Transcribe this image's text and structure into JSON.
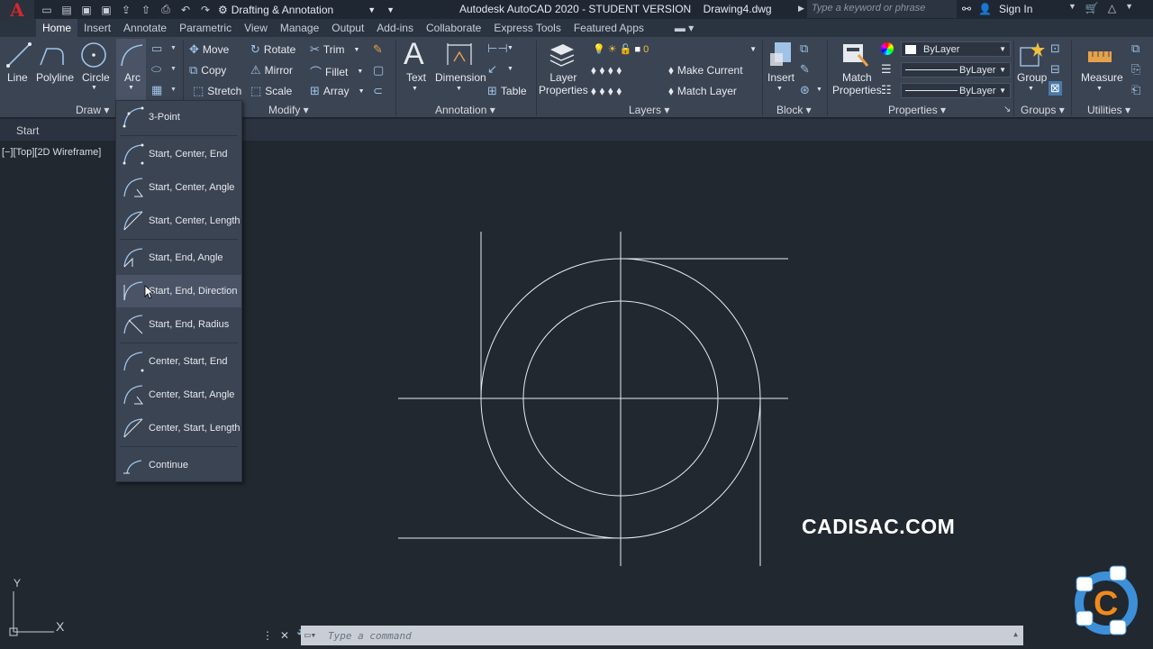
{
  "titlebar": {
    "workspace": "Drafting & Annotation",
    "app_title": "Autodesk AutoCAD 2020 - STUDENT VERSION",
    "drawing_name": "Drawing4.dwg",
    "search_placeholder": "Type a keyword or phrase",
    "signin_label": "Sign In"
  },
  "tabs": [
    "Home",
    "Insert",
    "Annotate",
    "Parametric",
    "View",
    "Manage",
    "Output",
    "Add-ins",
    "Collaborate",
    "Express Tools",
    "Featured Apps"
  ],
  "active_tab": "Home",
  "ribbon": {
    "draw": {
      "line": "Line",
      "polyline": "Polyline",
      "circle": "Circle",
      "arc": "Arc",
      "title": "Draw"
    },
    "modify": {
      "move": "Move",
      "rotate": "Rotate",
      "trim": "Trim",
      "copy": "Copy",
      "mirror": "Mirror",
      "fillet": "Fillet",
      "stretch": "Stretch",
      "scale": "Scale",
      "array": "Array",
      "title": "Modify"
    },
    "annotation": {
      "text": "Text",
      "dimension": "Dimension",
      "table": "Table",
      "title": "Annotation"
    },
    "layers": {
      "layer_properties_1": "Layer",
      "layer_properties_2": "Properties",
      "current_layer": "0",
      "make_current": "Make Current",
      "match_layer": "Match Layer",
      "title": "Layers"
    },
    "block": {
      "insert": "Insert",
      "title": "Block"
    },
    "properties": {
      "match_1": "Match",
      "match_2": "Properties",
      "color": "ByLayer",
      "linetype": "ByLayer",
      "lineweight": "ByLayer",
      "title": "Properties"
    },
    "groups": {
      "group": "Group",
      "title": "Groups"
    },
    "utilities": {
      "measure": "Measure",
      "title": "Utilities"
    }
  },
  "file_tab": "Start",
  "view_label": "[−][Top][2D Wireframe]",
  "arc_menu": [
    "3-Point",
    "Start, Center, End",
    "Start, Center, Angle",
    "Start, Center, Length",
    "Start, End, Angle",
    "Start, End, Direction",
    "Start, End, Radius",
    "Center, Start, End",
    "Center, Start, Angle",
    "Center, Start, Length",
    "Continue"
  ],
  "command_placeholder": "Type a command",
  "watermark": "CADISAC.COM",
  "ucs": {
    "x": "X",
    "y": "Y"
  },
  "colors": {
    "accent": "#9fc3e6",
    "background": "#212830",
    "ribbon": "#3b4453",
    "logo": "#d4272f"
  }
}
